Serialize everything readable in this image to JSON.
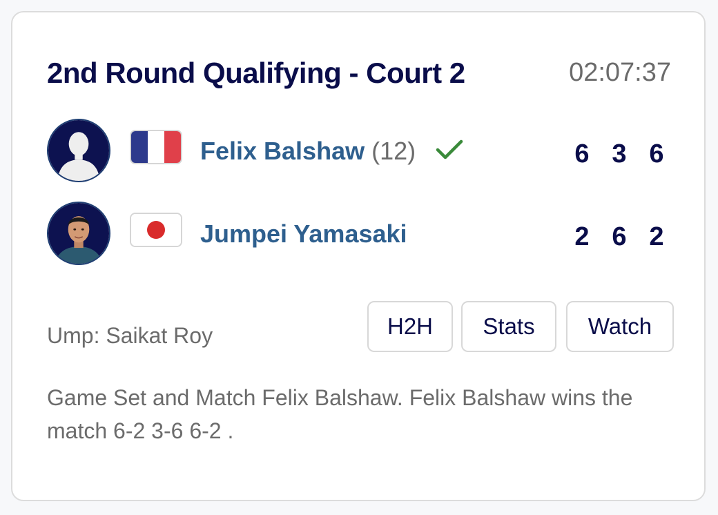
{
  "match": {
    "title": "2nd Round Qualifying - Court 2",
    "time": "02:07:37"
  },
  "players": [
    {
      "name": "Felix Balshaw",
      "seed": "(12)",
      "flag": "france-flag",
      "winner": true,
      "scores": [
        "6",
        "3",
        "6"
      ]
    },
    {
      "name": "Jumpei Yamasaki",
      "seed": "",
      "flag": "japan-flag",
      "winner": false,
      "scores": [
        "2",
        "6",
        "2"
      ]
    }
  ],
  "umpire": "Ump: Saikat Roy",
  "buttons": {
    "h2h": "H2H",
    "stats": "Stats",
    "watch": "Watch"
  },
  "summary": "Game Set and Match Felix Balshaw. Felix Balshaw wins the match 6-2 3-6 6-2 .",
  "colors": {
    "title": "#0a0d4a",
    "player_name": "#2e5f8e",
    "winner_check": "#3a8a3a",
    "muted_text": "#6b6b6b"
  },
  "icons": {
    "avatar_placeholder": "person-silhouette-icon",
    "avatar_photo": "player-photo",
    "winner": "checkmark-icon"
  }
}
